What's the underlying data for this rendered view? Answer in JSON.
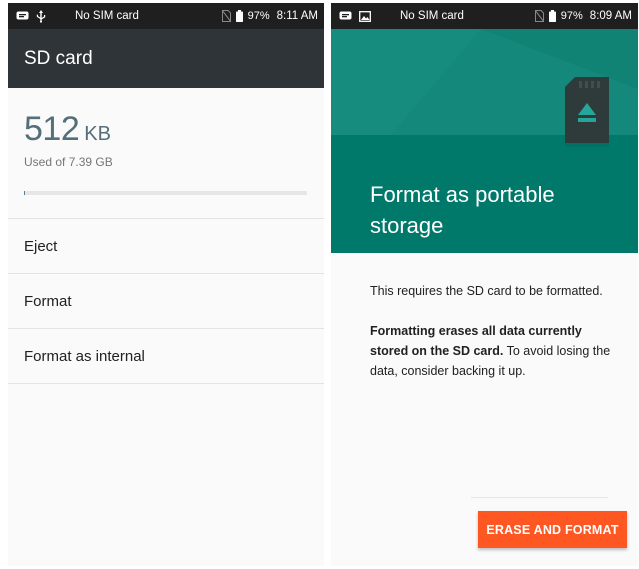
{
  "left": {
    "statusbar": {
      "carrier": "No SIM card",
      "battery": "97%",
      "time": "8:11 AM"
    },
    "appbar": {
      "title": "SD card"
    },
    "storage": {
      "value": "512",
      "unit": "KB",
      "caption": "Used of 7.39 GB",
      "used_fraction": 0.004
    },
    "menu": [
      {
        "label": "Eject"
      },
      {
        "label": "Format"
      },
      {
        "label": "Format as internal"
      }
    ]
  },
  "right": {
    "statusbar": {
      "carrier": "No SIM card",
      "battery": "97%",
      "time": "8:09 AM"
    },
    "hero": {
      "title": "Format as portable storage"
    },
    "body": {
      "p1": "This requires the SD card to be formatted.",
      "p2_bold": "Formatting erases all data currently stored on the SD card.",
      "p2_rest": " To avoid losing the data, consider backing it up."
    },
    "button": {
      "label": "ERASE AND FORMAT"
    }
  },
  "colors": {
    "teal_dark": "#00796b",
    "teal_light": "#13887b",
    "accent": "#ff5722",
    "appbar": "#2f3438",
    "storage_text": "#546e7a"
  }
}
